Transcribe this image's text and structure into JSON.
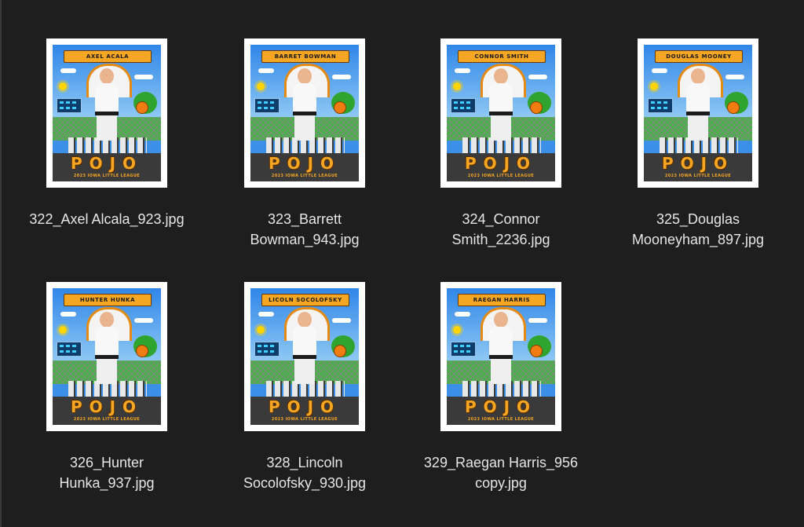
{
  "files": [
    {
      "filename": [
        "322_Axel Alcala_923.jpg"
      ],
      "poster_name": "AXEL ACALA"
    },
    {
      "filename": [
        "323_Barrett",
        "Bowman_943.jpg"
      ],
      "poster_name": "BARRET BOWMAN"
    },
    {
      "filename": [
        "324_Connor",
        "Smith_2236.jpg"
      ],
      "poster_name": "CONNOR SMITH"
    },
    {
      "filename": [
        "325_Douglas",
        "Mooneyham_897.jpg"
      ],
      "poster_name": "DOUGLAS MOONEY"
    },
    {
      "filename": [
        "326_Hunter",
        "Hunka_937.jpg"
      ],
      "poster_name": "HUNTER HUNKA"
    },
    {
      "filename": [
        "328_Lincoln",
        "Socolofsky_930.jpg"
      ],
      "poster_name": "LICOLN SOCOLOFSKY"
    },
    {
      "filename": [
        "329_Raegan Harris_956",
        "copy.jpg"
      ],
      "poster_name": "RAEGAN HARRIS"
    }
  ],
  "poster": {
    "brand": "POJO",
    "subtitle": "2023 IOWA LITTLE LEAGUE"
  },
  "colors": {
    "background": "#1e1e1e",
    "label_text": "#e6e6e6",
    "accent_orange": "#f5a623"
  }
}
